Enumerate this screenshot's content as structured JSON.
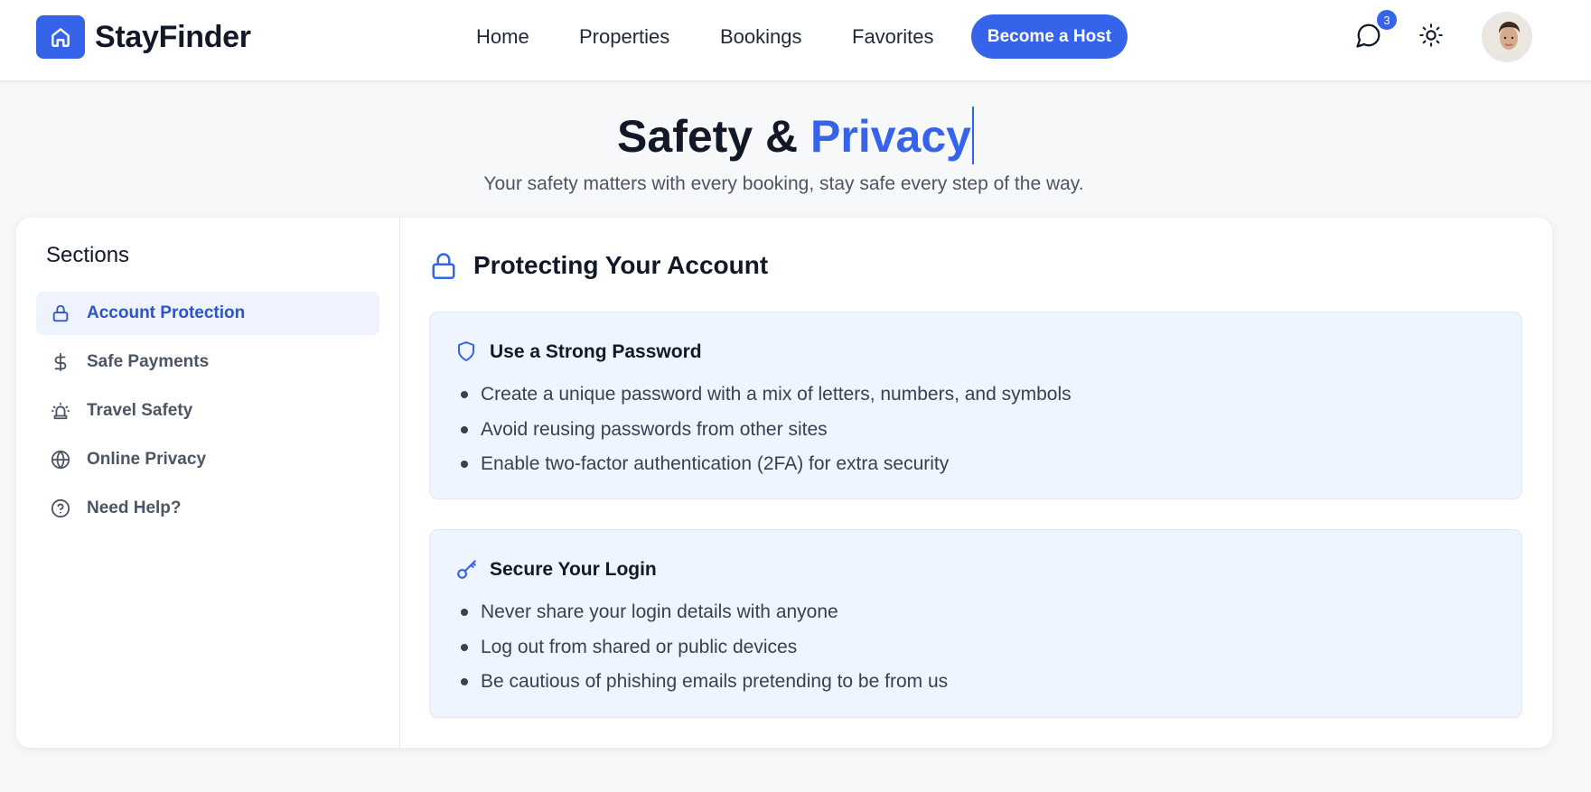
{
  "brand": {
    "name": "StayFinder",
    "logo_icon": "home-icon"
  },
  "nav": {
    "links": [
      {
        "label": "Home"
      },
      {
        "label": "Properties"
      },
      {
        "label": "Bookings"
      },
      {
        "label": "Favorites"
      }
    ],
    "cta_label": "Become a Host",
    "messages_icon": "message-circle-icon",
    "messages_badge": "3",
    "theme_icon": "sun-icon",
    "avatar_icon": "user-avatar"
  },
  "hero": {
    "title_part1": "Safety & ",
    "title_part2": "Privacy",
    "subtitle": "Your safety matters with every booking, stay safe every step of the way."
  },
  "sidebar": {
    "title": "Sections",
    "items": [
      {
        "label": "Account Protection",
        "icon": "lock-icon",
        "active": true
      },
      {
        "label": "Safe Payments",
        "icon": "dollar-icon",
        "active": false
      },
      {
        "label": "Travel Safety",
        "icon": "siren-icon",
        "active": false
      },
      {
        "label": "Online Privacy",
        "icon": "globe-icon",
        "active": false
      },
      {
        "label": "Need Help?",
        "icon": "help-circle-icon",
        "active": false
      }
    ]
  },
  "content": {
    "title": "Protecting Your Account",
    "title_icon": "lock-icon",
    "cards": [
      {
        "title": "Use a Strong Password",
        "icon": "shield-icon",
        "bullets": [
          "Create a unique password with a mix of letters, numbers, and symbols",
          "Avoid reusing passwords from other sites",
          "Enable two-factor authentication (2FA) for extra security"
        ]
      },
      {
        "title": "Secure Your Login",
        "icon": "key-icon",
        "bullets": [
          "Never share your login details with anyone",
          "Log out from shared or public devices",
          "Be cautious of phishing emails pretending to be from us"
        ]
      }
    ]
  },
  "colors": {
    "accent": "#3563e9",
    "active_bg": "#eef3fd",
    "card_bg": "#eff5fe"
  }
}
